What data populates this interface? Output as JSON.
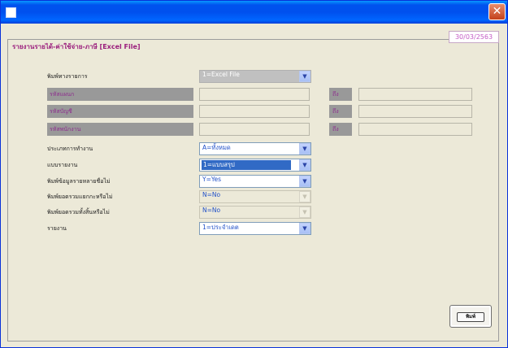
{
  "window": {
    "title": ""
  },
  "section_title": "รายงานรายได้-ค่าใช้จ่าย-ภาษี [Excel File]",
  "date": "30/03/2563",
  "fields": {
    "output_type": {
      "label": "พิมพ์ทางรายการ",
      "value": "1=Excel File"
    },
    "code_from": {
      "label": "รหัสแผนก",
      "to_label": "ถึง"
    },
    "account_from": {
      "label": "รหัสบัญชี",
      "to_label": "ถึง"
    },
    "employee_from": {
      "label": "รหัสพนักงาน",
      "to_label": "ถึง"
    },
    "work_type": {
      "label": "ประเภทการทำงาน",
      "value": "A=ทั้งหมด"
    },
    "report_format": {
      "label": "แบบรายงาน",
      "value": "1=แบบสรุป"
    },
    "print_ids": {
      "label": "พิมพ์ข้อมูลรายหลายชื่อไม่",
      "value": "Y=Yes"
    },
    "print_mode2": {
      "label": "พิมพ์ยอดรวมแยกกะหรือไม่",
      "value": "N=No"
    },
    "print_total": {
      "label": "พิมพ์ยอดรวมทั้งสิ้นหรือไม่",
      "value": "N=No"
    },
    "report": {
      "label": "รายงาน",
      "value": "1=ประจำเดต"
    }
  },
  "buttons": {
    "print": "พิมพ์"
  },
  "icons": {
    "close": "close-icon",
    "dropdown": "chevron-down-icon"
  },
  "colors": {
    "titlebar": "#0053ee",
    "label_accent": "#9b1e7d",
    "selection": "#316ac5"
  }
}
